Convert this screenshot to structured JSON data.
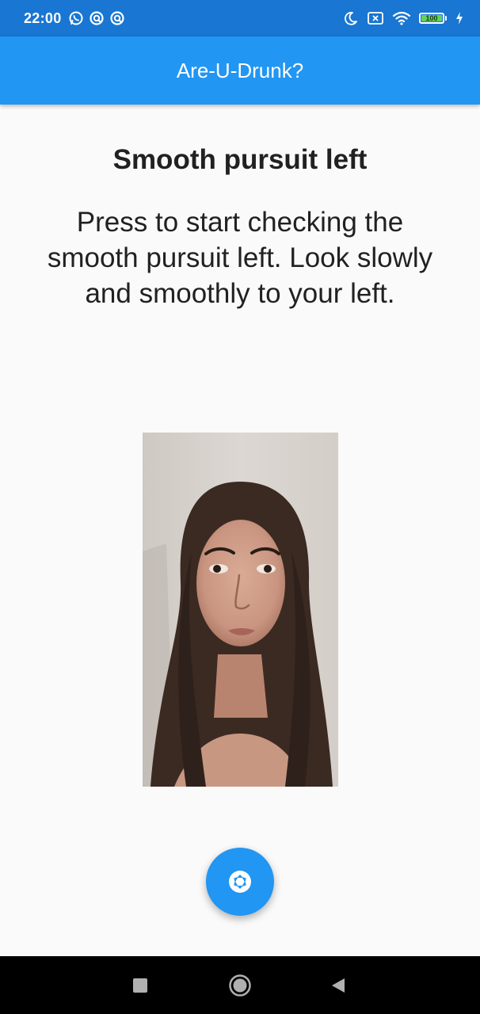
{
  "status_bar": {
    "time": "22:00",
    "left_icons": [
      "whatsapp-icon",
      "signal-app-icon",
      "signal-app-icon"
    ],
    "right_icons": [
      "moon-icon",
      "no-sim-icon",
      "wifi-icon",
      "battery-icon",
      "charging-icon"
    ],
    "battery_level": "100",
    "battery_fraction": 1.0,
    "battery_color": "#5fd35f"
  },
  "app_bar": {
    "title": "Are-U-Drunk?",
    "color": "#2196f3"
  },
  "main": {
    "heading": "Smooth pursuit left",
    "instructions": "Press to start checking the smooth pursuit left. Look slowly and smoothly to your left.",
    "camera_preview_icon": "camera-feed",
    "capture_button_icon": "camera-shutter-icon"
  },
  "nav_bar": {
    "buttons": [
      "recents-icon",
      "home-icon",
      "back-icon"
    ]
  }
}
